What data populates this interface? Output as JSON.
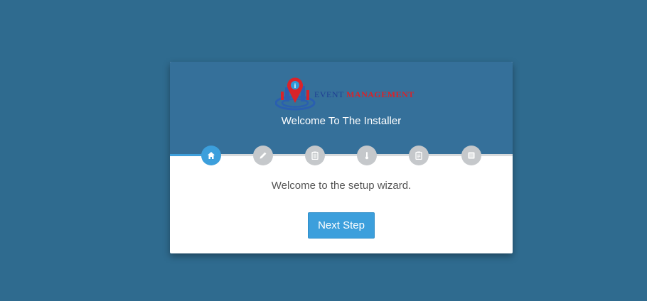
{
  "logo": {
    "icon": "map-pin-building-icon",
    "pin_letter": "i",
    "word1": "EVENT",
    "word2": "MANAGEMENT",
    "colors": {
      "blue": "#1f3f94",
      "red": "#d8232a"
    }
  },
  "header": {
    "title": "Welcome To The Installer"
  },
  "steps": [
    {
      "icon": "home-icon",
      "active": true
    },
    {
      "icon": "pencil-icon",
      "active": false
    },
    {
      "icon": "clipboard-icon",
      "active": false
    },
    {
      "icon": "thermometer-icon",
      "active": false
    },
    {
      "icon": "clipboard-list-icon",
      "active": false
    },
    {
      "icon": "list-icon",
      "active": false
    }
  ],
  "progress": {
    "fraction": 0.12
  },
  "main": {
    "intro": "Welcome to the setup wizard.",
    "next_label": "Next Step"
  },
  "colors": {
    "background": "#2f6b8f",
    "header": "#35709a",
    "accent": "#3c9fdc",
    "inactive_step": "#c5c8cb"
  }
}
